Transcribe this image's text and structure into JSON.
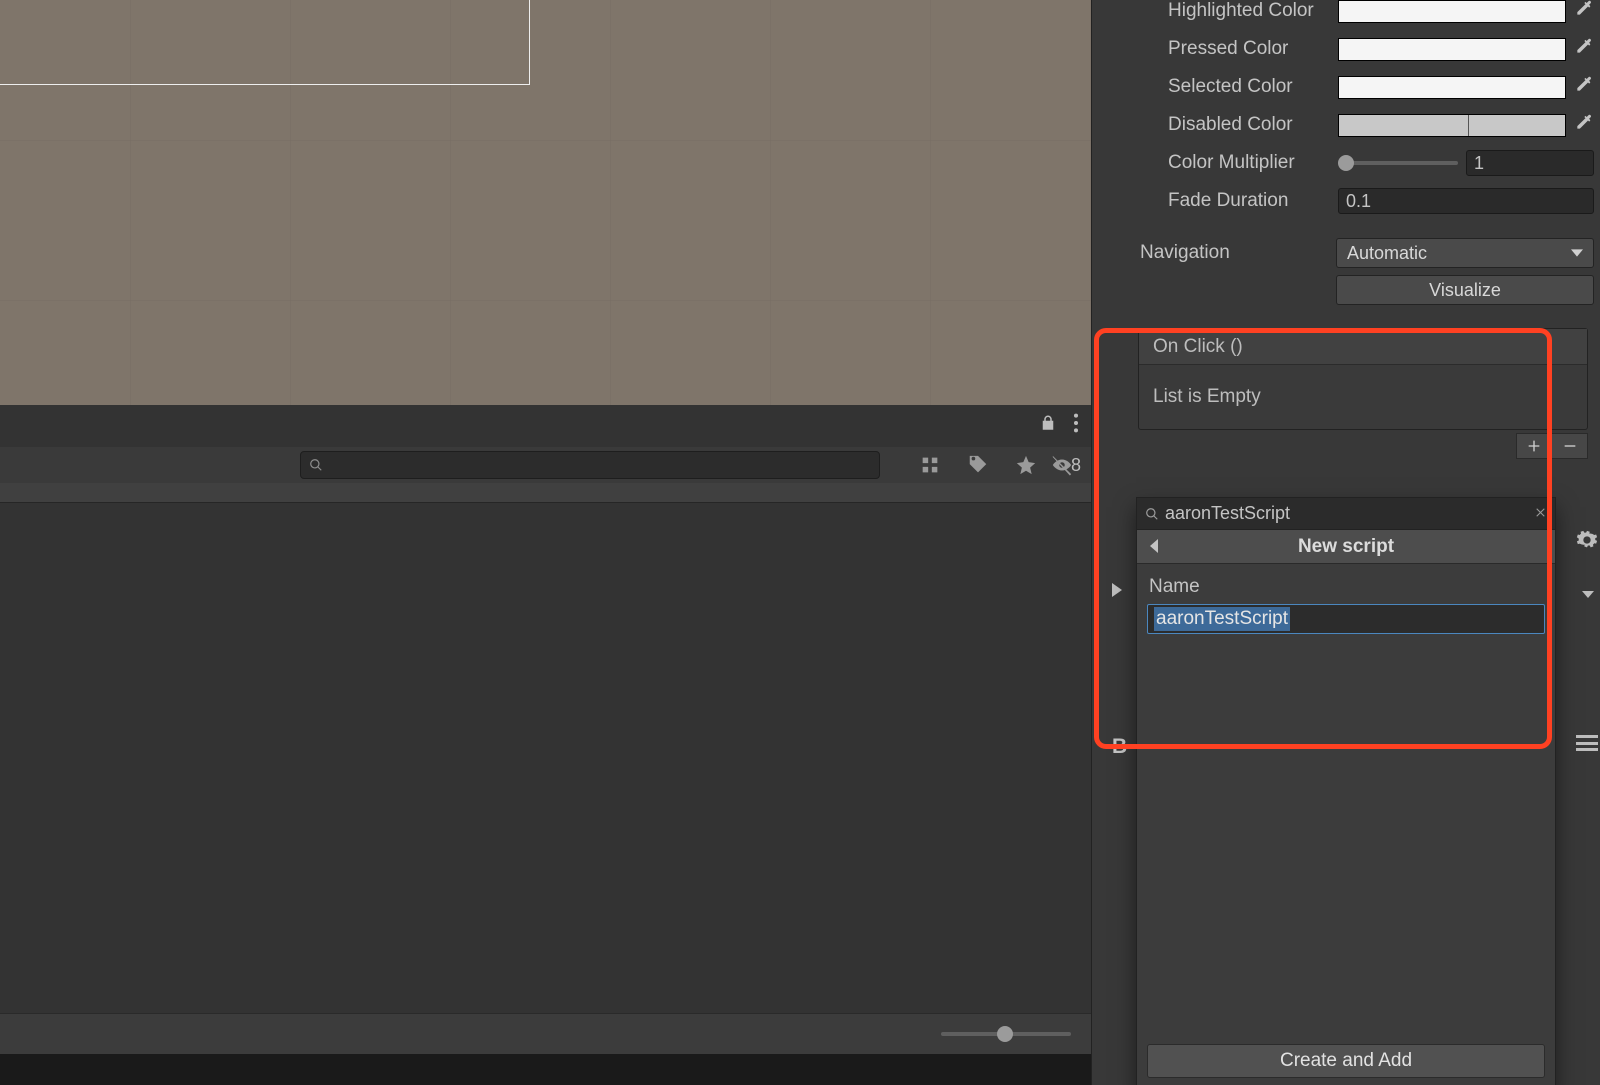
{
  "inspector": {
    "highlighted_color_label": "Highlighted Color",
    "pressed_color_label": "Pressed Color",
    "selected_color_label": "Selected Color",
    "disabled_color_label": "Disabled Color",
    "color_multiplier_label": "Color Multiplier",
    "color_multiplier_value": "1",
    "fade_duration_label": "Fade Duration",
    "fade_duration_value": "0.1",
    "navigation_label": "Navigation",
    "navigation_value": "Automatic",
    "visualize_label": "Visualize",
    "onclick_header": "On Click ()",
    "onclick_empty": "List is Empty"
  },
  "popup": {
    "search_value": "aaronTestScript",
    "header": "New script",
    "name_label": "Name",
    "name_value": "aaronTestScript",
    "create_label": "Create and Add"
  },
  "project": {
    "hidden_count": "8"
  },
  "misc": {
    "b_label": "B"
  }
}
